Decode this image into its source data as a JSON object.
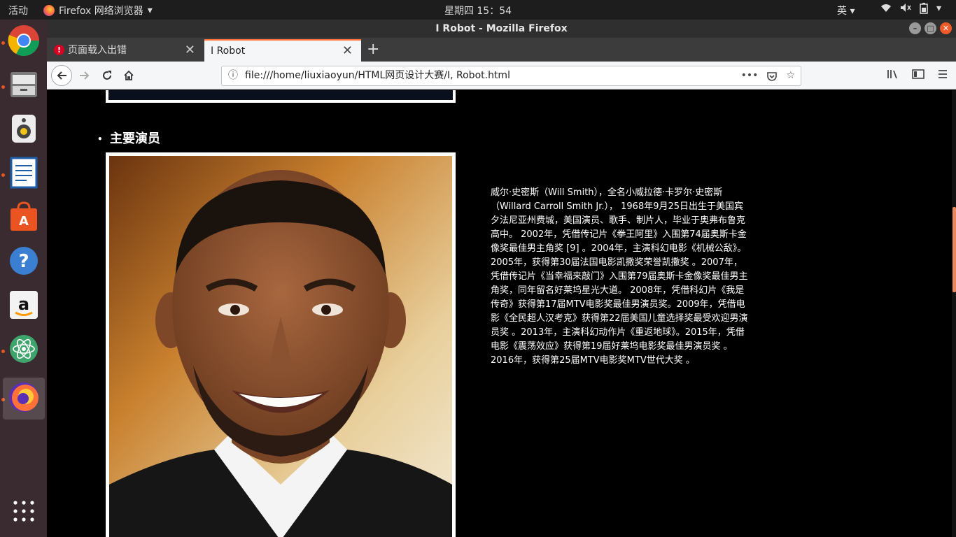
{
  "system": {
    "activities": "活动",
    "app_menu": "Firefox 网络浏览器",
    "clock": "星期四 15：54",
    "input_method": "英",
    "tray_icons": [
      "wifi-icon",
      "volume-icon",
      "battery-icon",
      "power-menu-icon"
    ]
  },
  "launcher": {
    "items": [
      {
        "name": "chrome",
        "icon": "chrome-icon",
        "running": true
      },
      {
        "name": "files",
        "icon": "file-cabinet-icon",
        "running": true
      },
      {
        "name": "rhythmbox",
        "icon": "speaker-icon",
        "running": false
      },
      {
        "name": "writer",
        "icon": "document-icon",
        "running": true
      },
      {
        "name": "software",
        "icon": "shopping-bag-icon",
        "running": false
      },
      {
        "name": "help",
        "icon": "help-icon",
        "running": false
      },
      {
        "name": "amazon",
        "icon": "amazon-icon",
        "running": false
      },
      {
        "name": "atom",
        "icon": "atom-icon",
        "running": true
      },
      {
        "name": "firefox",
        "icon": "firefox-icon",
        "running": true
      },
      {
        "name": "apps",
        "icon": "app-grid-icon",
        "running": false
      }
    ]
  },
  "window": {
    "title": "I Robot - Mozilla Firefox"
  },
  "tabs": [
    {
      "label": "页面载入出错",
      "active": false,
      "icon": "error-icon"
    },
    {
      "label": "I Robot",
      "active": true,
      "icon": ""
    }
  ],
  "toolbar": {
    "url": "file:///home/liuxiaoyun/HTML网页设计大赛/I, Robot.html"
  },
  "page": {
    "section_title": "主要演员",
    "bio": "威尔·史密斯（Will Smith），全名小威拉德·卡罗尔·史密斯（Willard Carroll Smith Jr.）， 1968年9月25日出生于美国宾夕法尼亚州费城，美国演员、歌手、制片人，毕业于奥弗布鲁克高中。 2002年，凭借传记片《拳王阿里》入围第74届奥斯卡金像奖最佳男主角奖 [9] 。2004年，主演科幻电影《机械公敌》。 2005年，获得第30届法国电影凯撒奖荣誉凯撒奖 。2007年，凭借传记片《当幸福来敲门》入围第79届奥斯卡金像奖最佳男主角奖，同年留名好莱坞星光大道。 2008年，凭借科幻片《我是传奇》获得第17届MTV电影奖最佳男演员奖。2009年，凭借电影《全民超人汉考克》获得第22届美国儿童选择奖最受欢迎男演员奖 。2013年，主演科幻动作片《重返地球》。2015年，凭借电影《震荡效应》获得第19届好莱坞电影奖最佳男演员奖 。2016年，获得第25届MTV电影奖MTV世代大奖 。"
  },
  "colors": {
    "accent": "#ff7139",
    "page_bg": "#000000",
    "launcher_bg": "#3a2b31"
  }
}
